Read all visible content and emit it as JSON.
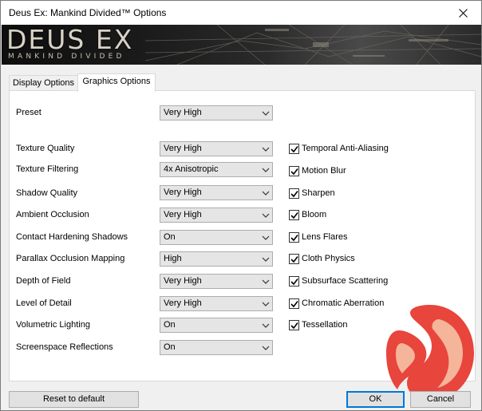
{
  "window": {
    "title": "Deus Ex: Mankind Divided™ Options"
  },
  "banner": {
    "logo_main": "DEUS EX",
    "logo_sub": "MANKIND DIVIDED"
  },
  "tabs": [
    {
      "label": "Display Options",
      "active": false
    },
    {
      "label": "Graphics Options",
      "active": true
    }
  ],
  "preset": {
    "label": "Preset",
    "value": "Very High"
  },
  "settings": [
    {
      "label": "Texture Quality",
      "value": "Very High"
    },
    {
      "label": "Texture Filtering",
      "value": "4x Anisotropic"
    },
    {
      "label": "Shadow Quality",
      "value": "Very High"
    },
    {
      "label": "Ambient Occlusion",
      "value": "Very High"
    },
    {
      "label": "Contact Hardening Shadows",
      "value": "On"
    },
    {
      "label": "Parallax Occlusion Mapping",
      "value": "High"
    },
    {
      "label": "Depth of Field",
      "value": "Very High"
    },
    {
      "label": "Level of Detail",
      "value": "Very High"
    },
    {
      "label": "Volumetric Lighting",
      "value": "On"
    },
    {
      "label": "Screenspace Reflections",
      "value": "On"
    }
  ],
  "checkboxes": [
    {
      "label": "Temporal Anti-Aliasing",
      "checked": true
    },
    {
      "label": "Motion Blur",
      "checked": true
    },
    {
      "label": "Sharpen",
      "checked": true
    },
    {
      "label": "Bloom",
      "checked": true
    },
    {
      "label": "Lens Flares",
      "checked": true
    },
    {
      "label": "Cloth Physics",
      "checked": true
    },
    {
      "label": "Subsurface Scattering",
      "checked": true
    },
    {
      "label": "Chromatic Aberration",
      "checked": true
    },
    {
      "label": "Tessellation",
      "checked": true
    }
  ],
  "buttons": {
    "reset": "Reset to default",
    "ok": "OK",
    "cancel": "Cancel"
  },
  "icons": {
    "close": "close-icon",
    "dropdown": "chevron-down-icon",
    "check": "checkmark-icon",
    "watermark": "logo-icon"
  },
  "colors": {
    "accent": "#0078d7",
    "watermark_red": "#e8453c",
    "watermark_peach": "#f5b59a"
  }
}
